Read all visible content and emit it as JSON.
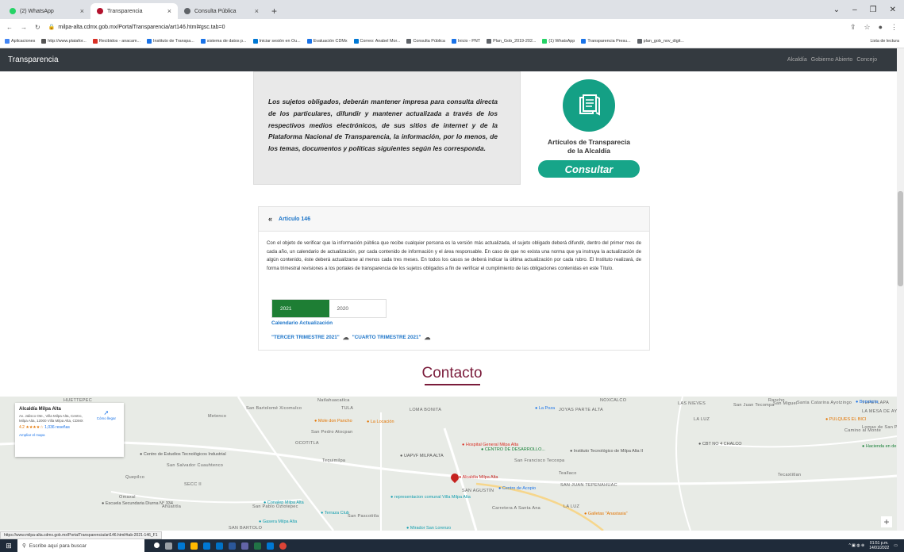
{
  "browser": {
    "tabs": [
      {
        "title": "(2) WhatsApp",
        "color": "#25d366",
        "active": false
      },
      {
        "title": "Transparencia",
        "color": "#b3122d",
        "active": true
      },
      {
        "title": "Consulta Pública",
        "color": "#5f6368",
        "active": false
      }
    ],
    "new_tab": "+",
    "url": "milpa-alta.cdmx.gob.mx/PortalTransparencia/art146.html#gsc.tab=0",
    "bookmarks": [
      {
        "label": "Aplicaciones",
        "color": "#4285f4"
      },
      {
        "label": "http://www.platafor...",
        "color": "#555555"
      },
      {
        "label": "Recibidos - anacam...",
        "color": "#d93025"
      },
      {
        "label": "Instituto de Transpa...",
        "color": "#1a73e8"
      },
      {
        "label": "sistema de datos p...",
        "color": "#1a73e8"
      },
      {
        "label": "Iniciar sesión en Ou...",
        "color": "#0078d4"
      },
      {
        "label": "Evaluación CDMx",
        "color": "#1a73e8"
      },
      {
        "label": "Correo: Anabel Mor...",
        "color": "#0078d4"
      },
      {
        "label": "Consulta Pública",
        "color": "#5f6368"
      },
      {
        "label": "Inicio - PNT",
        "color": "#1a73e8"
      },
      {
        "label": "Plan_Gob_2019-202...",
        "color": "#5f6368"
      },
      {
        "label": "(1) WhatsApp",
        "color": "#25d366"
      },
      {
        "label": "Transparencia Presu...",
        "color": "#1a73e8"
      },
      {
        "label": "plan_gob_nov_digit...",
        "color": "#5f6368"
      }
    ],
    "reading_list": "Lista de lectura"
  },
  "navbar": {
    "brand": "Transparencia",
    "links": [
      "Alcaldía",
      "Gobierno Abierto",
      "Concejo"
    ]
  },
  "quote": "Los sujetos obligados, deberán mantener impresa para consulta directa de los particulares, difundir y mantener actualizada a través de los respectivos medios electrónicos, de sus sitios de internet y de la Plataforma Nacional de Transparencia, la información, por lo menos, de los temas, documentos y políticas siguientes según les corresponda.",
  "articles_logo": {
    "title_line1": "Artículos de Transparecia",
    "title_line2": "de la Alcaldía",
    "button": "Consultar"
  },
  "article": {
    "title": "Articulo 146",
    "body": "Con el objeto de verificar que la información pública que recibe cualquier persona es la versión más actualizada, el sujeto obligado deberá difundir, dentro del primer mes de cada año, un calendario de actualización, por cada contenido de información y el área responsable. En caso de que no exista una norma que ya instruya la actualización de algún contenido, éste deberá actualizarse al menos cada tres meses. En todos los casos se deberá indicar la última actualización por cada rubro. El Instituto realizará, de forma trimestral revisiones a los portales de transparencia de los sujetos obligados a fin de verificar el cumplimiento de las obligaciones contenidas en este Título.",
    "years": [
      "2021",
      "2020"
    ],
    "calendar_label": "Calendario Actualización",
    "links": [
      "\"TERCER TRIMESTRE 2021\"",
      "\"CUARTO TRIMESTRE 2021\""
    ]
  },
  "contact_heading": "Contacto",
  "map": {
    "info": {
      "name": "Alcaldía Milpa Alta",
      "address": "Av. Jalisco Ote., Villa Milpa Alta, Centro, Milpa Alta, 12000 Villa Milpa Alta, CDMX",
      "rating": "4.2 ★★★★☆",
      "reviews": "1,036 reseñas",
      "larger_map": "Ampliar el mapa",
      "directions": "Cómo llegar"
    },
    "labels": [
      "HUETTEPEC",
      "Natlahuacatlca",
      "TULA",
      "Metenco",
      "San Bartolomé Xicomulco",
      "San Pedro Atocpan",
      "OCOTITLA",
      "Tequimilpa",
      "San Salvador Cuauhtenco",
      "Quepilco",
      "SECC II",
      "Omaxal",
      "Ahuatitla",
      "San Pablo Oztotepec",
      "San Pascotitla",
      "SAN BARTOLO",
      "LOMA BONITA",
      "JOYAS PARTE ALTA",
      "San Francisco Tecoxpa",
      "SAN JUAN TEPENAHUAC",
      "SAN AGUSTÍN",
      "LA LUZ",
      "Carretera A Santa Ana",
      "Tecaxtitlan",
      "LAS NIEVES",
      "San Juan Tecompa",
      "San Miguel",
      "Santa Catarina Ayotzingo",
      "LA MESA DE AYOTZINGO",
      "Camino al Monte",
      "Lomas de San Pablo",
      "NOXCALCO",
      "Rancho",
      "TEPETLAPA",
      "LA LUZ",
      "Teallaco"
    ],
    "pois": [
      {
        "name": "Alcaldía Milpa Alta",
        "color": "#c5221f"
      },
      {
        "name": "Hospital General Milpa Alta",
        "color": "#d93025"
      },
      {
        "name": "CENTRO DE DESARROLLO...",
        "color": "#188038"
      },
      {
        "name": "UAPVF MILPA ALTA",
        "color": "#555555"
      },
      {
        "name": "Mole don Pancho",
        "color": "#e37400"
      },
      {
        "name": "La Locación",
        "color": "#e37400"
      },
      {
        "name": "Centro de Acopio",
        "color": "#1a73e8"
      },
      {
        "name": "representacion comunal Villa Milpa Alta",
        "color": "#129eaf"
      },
      {
        "name": "Conalep Milpa Alta",
        "color": "#129eaf"
      },
      {
        "name": "Terraza Club",
        "color": "#129eaf"
      },
      {
        "name": "Gasera Milpa Alta",
        "color": "#129eaf"
      },
      {
        "name": "Galletas \"Anastasia\"",
        "color": "#e37400"
      },
      {
        "name": "Centro de Estudios Tecnológicos Industrial",
        "color": "#555555"
      },
      {
        "name": "Escuela Secundaria Diurna N° 334",
        "color": "#555555"
      },
      {
        "name": "Instituto Tecnológico de Milpa Alta II",
        "color": "#555555"
      },
      {
        "name": "CBT NO 4 CHALCO",
        "color": "#555555"
      },
      {
        "name": "PULQUES EL BICI",
        "color": "#e37400"
      },
      {
        "name": "Boneteria",
        "color": "#1a73e8"
      },
      {
        "name": "Hacienda en de nuevo Izta",
        "color": "#188038"
      },
      {
        "name": "Mirador San Lorenzo",
        "color": "#129eaf"
      },
      {
        "name": "La Poza",
        "color": "#1a73e8"
      }
    ],
    "zoom_in": "+"
  },
  "status_url": "https://www.milpa-alta.cdmx.gob.mx/PortalTransparencia/art146.html#tab-2021-146_F1",
  "taskbar": {
    "search_placeholder": "Escribe aquí para buscar",
    "time": "01:51 p.m.",
    "date": "14/01/2022"
  }
}
